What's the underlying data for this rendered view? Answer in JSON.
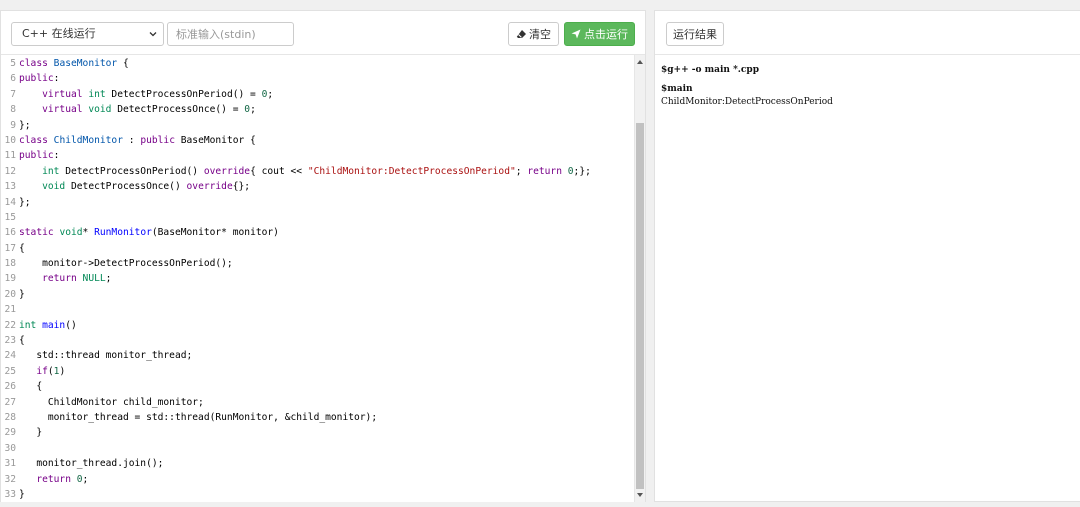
{
  "toolbar": {
    "language": "C++ 在线运行",
    "stdin_placeholder": "标准输入(stdin)",
    "clear_label": "清空",
    "run_label": "点击运行"
  },
  "result": {
    "button_label": "运行结果",
    "command": "$g++ -o main *.cpp",
    "prompt": "$main",
    "output": "ChildMonitor:DetectProcessOnPeriod"
  },
  "editor": {
    "lines": [
      {
        "n": "5",
        "html": "<span class='kw'>class</span> <span class='cls'>BaseMonitor</span> {"
      },
      {
        "n": "6",
        "html": "<span class='kw'>public</span>:"
      },
      {
        "n": "7",
        "html": "    <span class='kw'>virtual</span> <span class='typ'>int</span> DetectProcessOnPeriod() = <span class='num'>0</span>;"
      },
      {
        "n": "8",
        "html": "    <span class='kw'>virtual</span> <span class='typ'>void</span> DetectProcessOnce() = <span class='num'>0</span>;"
      },
      {
        "n": "9",
        "html": "};"
      },
      {
        "n": "10",
        "html": "<span class='kw'>class</span> <span class='cls'>ChildMonitor</span> : <span class='kw'>public</span> BaseMonitor {"
      },
      {
        "n": "11",
        "html": "<span class='kw'>public</span>:"
      },
      {
        "n": "12",
        "html": "    <span class='typ'>int</span> DetectProcessOnPeriod() <span class='kw'>override</span>{ cout &lt;&lt; <span class='str'>\"ChildMonitor:DetectProcessOnPeriod\"</span>; <span class='kw'>return</span> <span class='num'>0</span>;};"
      },
      {
        "n": "13",
        "html": "    <span class='typ'>void</span> DetectProcessOnce() <span class='kw'>override</span>{};"
      },
      {
        "n": "14",
        "html": "};"
      },
      {
        "n": "15",
        "html": ""
      },
      {
        "n": "16",
        "html": "<span class='kw'>static</span> <span class='typ'>void</span>* <span class='fn'>RunMonitor</span>(BaseMonitor* monitor)"
      },
      {
        "n": "17",
        "html": "{"
      },
      {
        "n": "18",
        "html": "    monitor-&gt;DetectProcessOnPeriod();"
      },
      {
        "n": "19",
        "html": "    <span class='kw'>return</span> <span class='typ'>NULL</span>;"
      },
      {
        "n": "20",
        "html": "}"
      },
      {
        "n": "21",
        "html": ""
      },
      {
        "n": "22",
        "html": "<span class='typ'>int</span> <span class='fn'>main</span>()"
      },
      {
        "n": "23",
        "html": "{"
      },
      {
        "n": "24",
        "html": "   std::thread monitor_thread;"
      },
      {
        "n": "25",
        "html": "   <span class='kw'>if</span>(<span class='num'>1</span>)"
      },
      {
        "n": "26",
        "html": "   {"
      },
      {
        "n": "27",
        "html": "     ChildMonitor child_monitor;"
      },
      {
        "n": "28",
        "html": "     monitor_thread = std::thread(RunMonitor, &amp;child_monitor);"
      },
      {
        "n": "29",
        "html": "   }"
      },
      {
        "n": "30",
        "html": ""
      },
      {
        "n": "31",
        "html": "   monitor_thread.join();"
      },
      {
        "n": "32",
        "html": "   <span class='kw'>return</span> <span class='num'>0</span>;"
      },
      {
        "n": "33",
        "html": "}"
      }
    ]
  },
  "colors": {
    "run_button": "#5cb85c",
    "keyword": "#770088",
    "type": "#008855",
    "string": "#aa1111",
    "number": "#116644"
  }
}
